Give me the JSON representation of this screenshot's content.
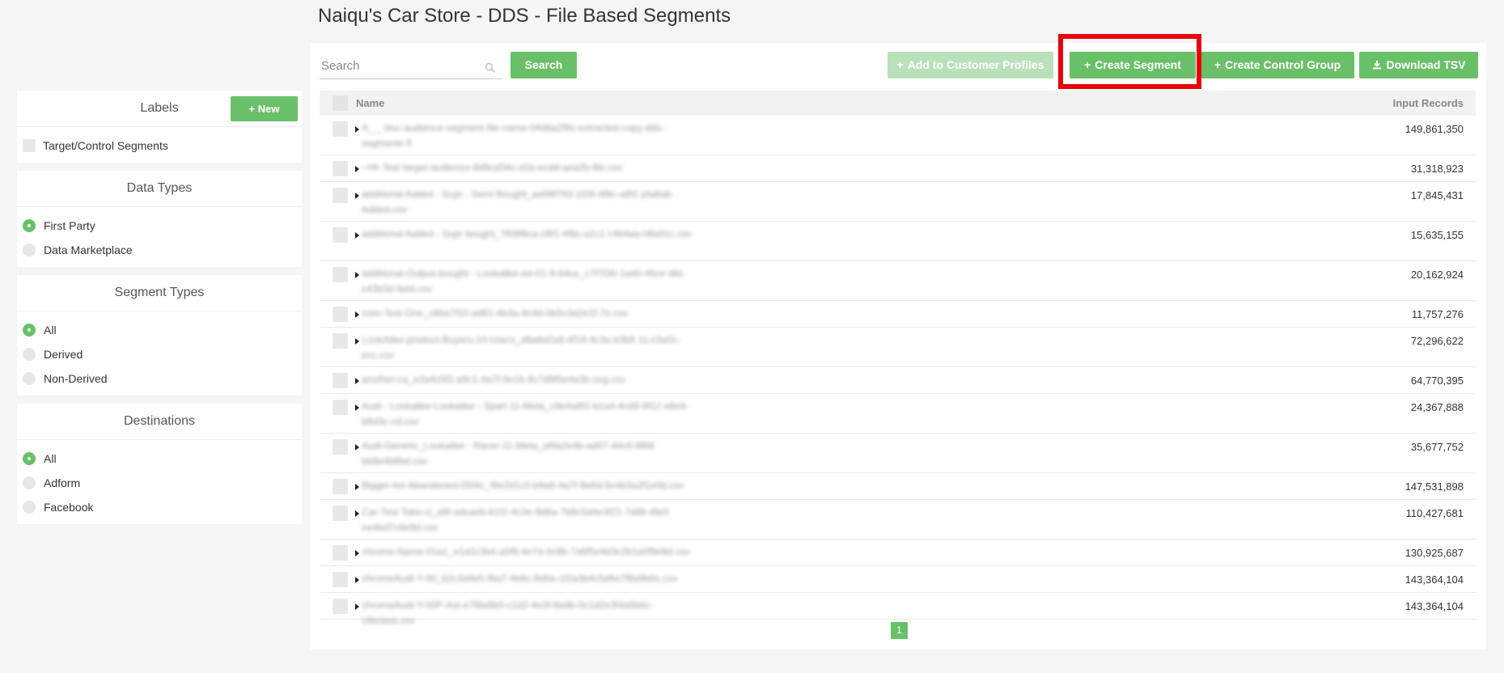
{
  "page": {
    "title": "Naiqu's Car Store - DDS - File Based Segments"
  },
  "sidebar": {
    "labels": {
      "title": "Labels",
      "new_label": "New",
      "items": [
        {
          "label": "Target/Control Segments",
          "checked": false
        }
      ]
    },
    "data_types": {
      "title": "Data Types",
      "options": [
        {
          "label": "First Party",
          "selected": true
        },
        {
          "label": "Data Marketplace",
          "selected": false
        }
      ]
    },
    "segment_types": {
      "title": "Segment Types",
      "options": [
        {
          "label": "All",
          "selected": true
        },
        {
          "label": "Derived",
          "selected": false
        },
        {
          "label": "Non-Derived",
          "selected": false
        }
      ]
    },
    "destinations": {
      "title": "Destinations",
      "options": [
        {
          "label": "All",
          "selected": true
        },
        {
          "label": "Adform",
          "selected": false
        },
        {
          "label": "Facebook",
          "selected": false
        }
      ]
    }
  },
  "toolbar": {
    "search_placeholder": "Search",
    "search_value": "",
    "search_button": "Search",
    "add_to_profiles": "Add to Customer Profiles",
    "create_segment": "Create Segment",
    "create_control_group": "Create Control Group",
    "download_tsv": "Download TSV"
  },
  "table": {
    "columns": {
      "name": "Name",
      "records": "Input Records"
    },
    "rows": [
      {
        "name": "A_ _ blur-audience-segment-file-name-04d8a2f9c-extracted-copy-dds-segments fl",
        "records": "149,861,350",
        "lines": 2
      },
      {
        "name": "~Hh Test target-audience-8d9cd34c-d1b-ecdd-aea2b-file.csv",
        "records": "31,318,923",
        "lines": 1
      },
      {
        "name": "additional Added - Supr - Semi Bought_aa98f793-1f28-4f8c-a9f1 pfa8ab-Added.csv",
        "records": "17,845,431",
        "lines": 2
      },
      {
        "name": "additional Added - Supr bought_7f09f9ca-c8f1-4f8c-a1c1 c4b4aa-06a91c.csv",
        "records": "15,635,155",
        "lines": 2
      },
      {
        "name": "additional-Output-bought - Lookalike-ed-01-9-64ce_c7f7f36-1a40-45ce dfd-c43b3d-field.csv",
        "records": "20,162,924",
        "lines": 2
      },
      {
        "name": "core-Test-One_c6ba7f10-ad81-4b3a-9c4d-0b5c3d2e1f-7e.csv",
        "records": "11,757,276",
        "lines": 1
      },
      {
        "name": "LookAlike-product-Buyers-10-Users_d8a8d2a6-4f19-4c3e-b3b5 11-c3a0c-ecc.csv",
        "records": "72,296,622",
        "lines": 2
      },
      {
        "name": "another-ca_e2a4c5f2-a9c1-4a7f-9e1b-8c7d6f5e4a3b-seg.csv",
        "records": "64,770,395",
        "lines": 1
      },
      {
        "name": "Audi - Lookalike-Lookalike - Spart 11-Meta_c9e4a8f2-b1a4-4cd9-9f12 e8e9-b8d3c-cd.csv",
        "records": "24,367,888",
        "lines": 2
      },
      {
        "name": "Audi-Generic_Lookalike - Racer-11-Meta_af9a2e4b-ad07-44c6-8f66 bb8e4b6bd.csv",
        "records": "35,677,752",
        "lines": 2
      },
      {
        "name": "Bigger-list-Abandoned-05f4c_f8e2d1c0-b9a8-4a7f-9e6d-5c4b3a2f1e0d.csv",
        "records": "147,531,898",
        "lines": 1
      },
      {
        "name": "Car-Test Take-ci_a9f-adcaeb-b1f2-4c3e-9d8a-7b6c5d4e3f21-7a9b-4fe0 ee4bd7c8e9d.csv",
        "records": "110,427,681",
        "lines": 2
      },
      {
        "name": "chrome-Name-01a1_e1d2c3b4-a5f6-4e7d-9c8b-7a6f5e4d3c2b1a0f9e8d.csv",
        "records": "130,925,687",
        "lines": 1
      },
      {
        "name": "chromeAudi-Y-00_b2c3d4e5-f6a7-4b8c-9d0e-1f2a3b4c5d6e7f8a9b0c.csv",
        "records": "143,364,104",
        "lines": 1
      },
      {
        "name": "chromeAudi-Y-00P-Ast-e7f8a9b0-c1d2-4e3f-8a9b-0c1d2e3f4a5b6c-Ulticlass.csv",
        "records": "143,364,104",
        "lines": 1
      }
    ]
  },
  "pagination": {
    "current": "1"
  },
  "colors": {
    "accent": "#6abf69",
    "accent_disabled": "#b9e0b9",
    "highlight": "#e8000b"
  }
}
